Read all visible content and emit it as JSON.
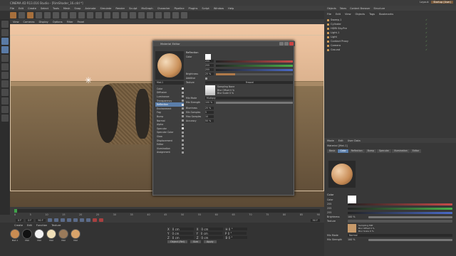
{
  "window": {
    "title": "CINEMA 4D R13.016 Studio - [RimShader_16.c4d *]"
  },
  "layout": {
    "label": "Layout:",
    "current": "Startup (User)"
  },
  "app_menu": [
    "File",
    "Edit",
    "Create",
    "Select",
    "Tools",
    "Mesh",
    "Snap",
    "Animate",
    "Simulate",
    "Render",
    "Sculpt",
    "MoGraph",
    "Character",
    "Pipeline",
    "Plugins",
    "Script",
    "Window",
    "Help"
  ],
  "viewport": {
    "menu": [
      "View",
      "Cameras",
      "Display",
      "Options",
      "Filter",
      "Panel"
    ]
  },
  "timeline": {
    "ticks": [
      "0",
      "5",
      "10",
      "15",
      "20",
      "25",
      "30",
      "35",
      "40",
      "45",
      "50",
      "55",
      "60",
      "65",
      "70",
      "75",
      "80",
      "85",
      "90"
    ],
    "start_frame": "0 F",
    "end_frame": "90 F",
    "current_frame": "0 F",
    "frame_end_field": "90 F"
  },
  "material_manager": {
    "menu": [
      "Create",
      "Edit",
      "Function",
      "Texture"
    ],
    "materials": [
      {
        "name": "Mat.1",
        "color": "#c98c52"
      },
      {
        "name": "Mat",
        "color": "#111111"
      },
      {
        "name": "Mat",
        "color": "#f2f2f2"
      },
      {
        "name": "Mat",
        "color": "#f1e0b8"
      },
      {
        "name": "Mat",
        "color": "#9a7a5a"
      },
      {
        "name": "Mat",
        "color": "#d8a36a"
      }
    ]
  },
  "coords": {
    "rows": [
      {
        "axis": "X",
        "pos": "0 cm",
        "size": "0 cm",
        "rot": "H 0 °"
      },
      {
        "axis": "Y",
        "pos": "0 cm",
        "size": "0 cm",
        "rot": "P 0 °"
      },
      {
        "axis": "Z",
        "pos": "0 cm",
        "size": "0 cm",
        "rot": "B 0 °"
      }
    ],
    "mode": "Object (Rel)",
    "size_mode": "Size",
    "apply": "Apply"
  },
  "right_tabs": [
    "Objects",
    "Takes",
    "Content Browser",
    "Structure"
  ],
  "object_menu": [
    "File",
    "Edit",
    "View",
    "Objects",
    "Tags",
    "Bookmarks"
  ],
  "objects": [
    {
      "name": "Sweep.1",
      "selected": false
    },
    {
      "name": "Cylinder",
      "selected": false
    },
    {
      "name": "HDRI Sky.Pre",
      "selected": false
    },
    {
      "name": "Light.1",
      "selected": false
    },
    {
      "name": "Light",
      "selected": false
    },
    {
      "name": "Contact Proxy",
      "selected": false
    },
    {
      "name": "Camera",
      "selected": false
    },
    {
      "name": "Ground",
      "selected": false
    }
  ],
  "attributes": {
    "menu": [
      "Mode",
      "Edit",
      "User Data"
    ],
    "title": "Material [Mat.1]",
    "tabs": [
      "Basic",
      "Color",
      "Reflection",
      "Bump",
      "Specular",
      "Illumination",
      "Editor"
    ],
    "active_tab": "Color",
    "group": "Color",
    "color_label": "Color",
    "rgb": [
      "255",
      "255",
      "255"
    ],
    "brightness_label": "Brightness",
    "brightness": "100 %",
    "texture_label": "Texture",
    "sampling_label": "Sampling",
    "sampling": "MIP",
    "blur_offset_label": "Blur Offset",
    "blur_offset": "0 %",
    "blur_scale_label": "Blur Scale",
    "blur_scale": "0 %",
    "mix_mode_label": "Mix Mode",
    "mix_mode": "Normal",
    "mix_strength_label": "Mix Strength",
    "mix_strength": "100 %"
  },
  "material_editor": {
    "title": "Material Editor",
    "menu": [
      "Mat.1"
    ],
    "name": "Mat.1",
    "channels": [
      {
        "label": "Color",
        "checked": true
      },
      {
        "label": "Diffusion",
        "checked": false
      },
      {
        "label": "Luminance",
        "checked": false
      },
      {
        "label": "Transparency",
        "checked": false
      },
      {
        "label": "Reflection",
        "checked": true
      },
      {
        "label": "Environment",
        "checked": false
      },
      {
        "label": "Fog",
        "checked": false
      },
      {
        "label": "Bump",
        "checked": false
      },
      {
        "label": "Normal",
        "checked": false
      },
      {
        "label": "Alpha",
        "checked": false
      },
      {
        "label": "Specular",
        "checked": true
      },
      {
        "label": "Specular Color",
        "checked": false
      },
      {
        "label": "Glow",
        "checked": false
      },
      {
        "label": "Displacement",
        "checked": false
      },
      {
        "label": "Editor",
        "checked": false
      },
      {
        "label": "Illumination",
        "checked": false
      },
      {
        "label": "Assignment",
        "checked": false
      }
    ],
    "active_channel": "Reflection",
    "section": "Reflection",
    "color_label": "Color",
    "rgb": [
      "255",
      "255",
      "255"
    ],
    "brightness_label": "Brightness",
    "brightness": "25 %",
    "additive_label": "Additive",
    "texture_label": "Texture",
    "texture_name": "Fresnel",
    "sampling_label": "Sampling",
    "sampling": "None",
    "blur_offset_label": "Blur Offset",
    "blur_offset": "0 %",
    "blur_scale_label": "Blur Scale",
    "blur_scale": "0 %",
    "mix_mode_label": "Mix Mode",
    "mix_mode": "Multiply",
    "mix_strength_label": "Mix Strength",
    "mix_strength": "100 %",
    "blurriness_label": "Blurriness",
    "blurriness": "25 %",
    "min_samples_label": "Min Samples",
    "min_samples": "5",
    "max_samples_label": "Max Samples",
    "max_samples": "10",
    "accuracy_label": "Accuracy",
    "accuracy": "50 %"
  },
  "colors": {
    "accent": "#5b7eaa",
    "active_tool": "#a76f3c",
    "green_marker": "#3fa24a",
    "red": "#c84a4a",
    "green": "#4ab04a",
    "blue": "#4a6ac8"
  }
}
